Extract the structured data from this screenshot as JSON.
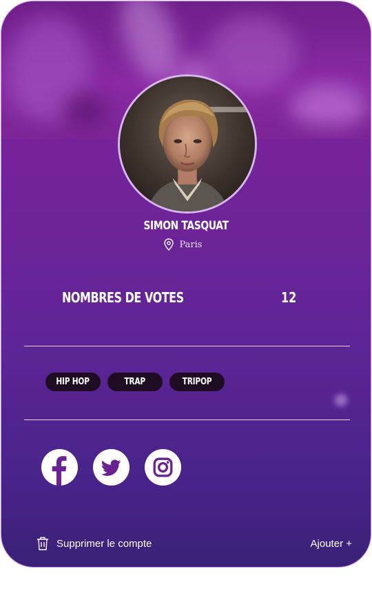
{
  "profile": {
    "name": "SIMON TASQUAT",
    "location": "Paris",
    "votes_label": "NOMBRES DE VOTES",
    "votes_value": "12"
  },
  "tags": [
    {
      "label": "HIP HOP"
    },
    {
      "label": "TRAP"
    },
    {
      "label": "TRIPOP"
    }
  ],
  "socials": [
    {
      "icon": "facebook-icon"
    },
    {
      "icon": "twitter-icon"
    },
    {
      "icon": "instagram-icon"
    }
  ],
  "actions": {
    "delete_label": "Supprimer le compte",
    "add_label": "Ajouter +"
  },
  "colors": {
    "card_top": "#7f2498",
    "card_bottom": "#3a2176",
    "card_border": "#c78ae8",
    "tag_bg": "#1e0d22"
  }
}
